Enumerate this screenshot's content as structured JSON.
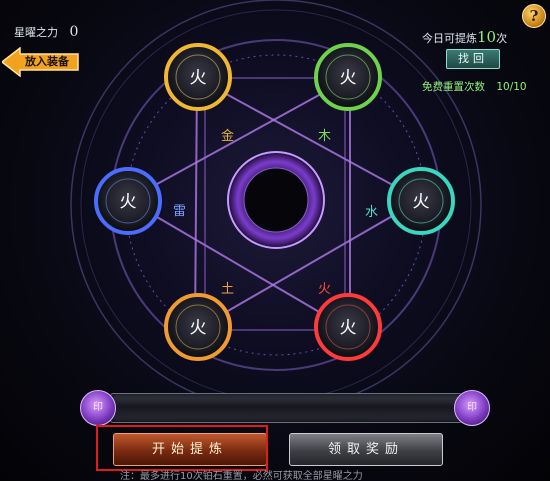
{
  "header": {
    "power_label": "星曜之力",
    "power_value": "0",
    "today_label_prefix": "今日可提炼",
    "today_count": "10",
    "today_label_suffix": "次",
    "reset_label": "免费重置次数",
    "reset_value": "10/10"
  },
  "buttons": {
    "back": "放入装备",
    "find": "找回",
    "help": "?",
    "start": "开始提炼",
    "claim": "领取奖励"
  },
  "wheel": {
    "node_glyph": "火",
    "elements": [
      {
        "name": "金",
        "color": "#e2b53a"
      },
      {
        "name": "木",
        "color": "#7ed957"
      },
      {
        "name": "雷",
        "color": "#7aa0ff"
      },
      {
        "name": "水",
        "color": "#4fe0c9"
      },
      {
        "name": "土",
        "color": "#f0a040"
      },
      {
        "name": "火",
        "color": "#ff4a3a"
      }
    ],
    "nodes": [
      {
        "id": "top-left",
        "color": "#f0b830"
      },
      {
        "id": "top-right",
        "color": "#6ed24a"
      },
      {
        "id": "left",
        "color": "#4a6cff"
      },
      {
        "id": "right",
        "color": "#39d6c0"
      },
      {
        "id": "bottom-left",
        "color": "#f09a30"
      },
      {
        "id": "bottom-right",
        "color": "#ff3a3a"
      }
    ]
  },
  "progress": {
    "fraction": 0,
    "left_cap_glyph": "印",
    "right_cap_glyph": "印"
  },
  "footer": {
    "note": "注：最多进行10次铂石重置，必然可获取全部星曜之力"
  },
  "colors": {
    "accent_purple": "#a05cff",
    "highlight_red": "#e01b1b"
  }
}
